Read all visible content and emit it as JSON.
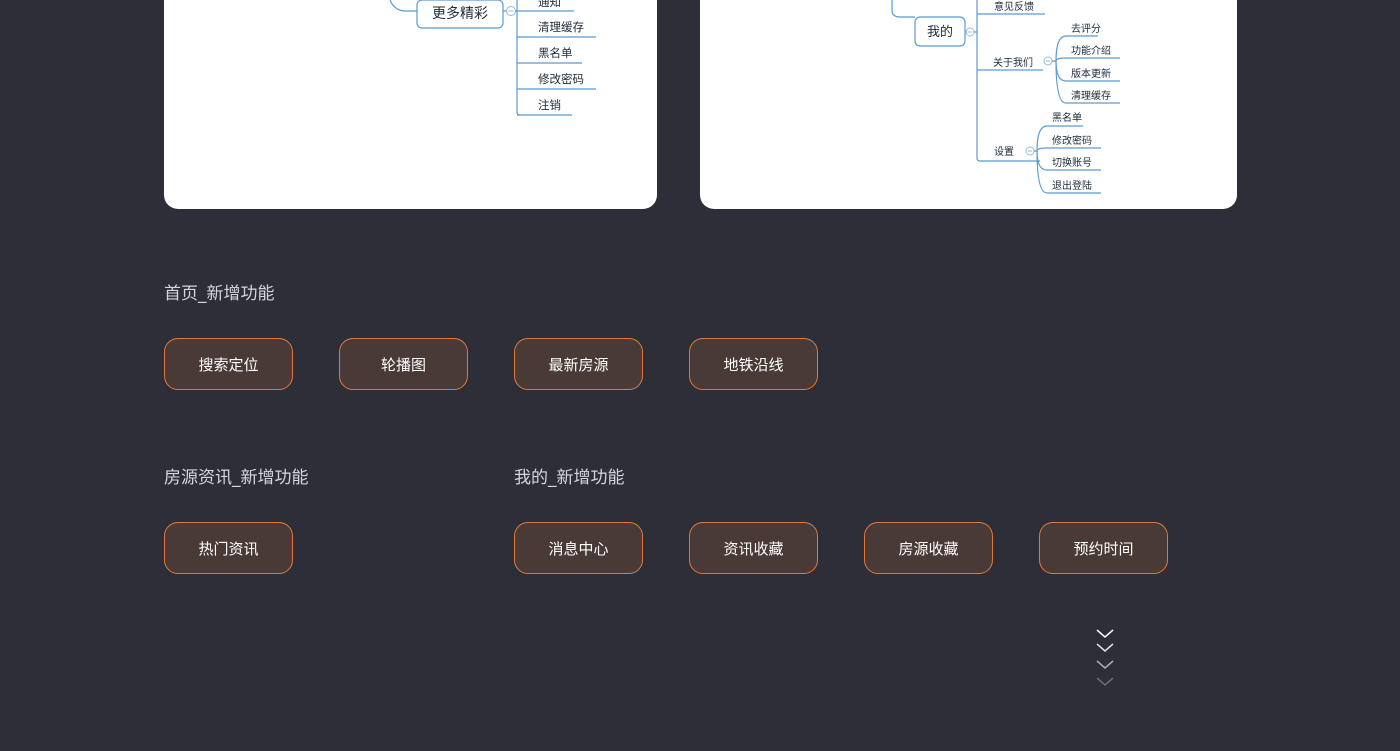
{
  "mindmap_left": {
    "parent": "更多精彩",
    "children": [
      "通知",
      "清理缓存",
      "黑名单",
      "修改密码",
      "注销"
    ]
  },
  "mindmap_right": {
    "root": "我的",
    "top_item": "意见反馈",
    "about": {
      "label": "关于我们",
      "items": [
        "去评分",
        "功能介绍",
        "版本更新",
        "清理缓存"
      ]
    },
    "settings": {
      "label": "设置",
      "items": [
        "黑名单",
        "修改密码",
        "切换账号",
        "退出登陆"
      ]
    }
  },
  "sections": {
    "home": {
      "title": "首页_新增功能",
      "buttons": [
        "搜索定位",
        "轮播图",
        "最新房源",
        "地铁沿线"
      ]
    },
    "news": {
      "title": "房源资讯_新增功能",
      "buttons": [
        "热门资讯"
      ]
    },
    "mine": {
      "title": "我的_新增功能",
      "buttons": [
        "消息中心",
        "资讯收藏",
        "房源收藏",
        "预约时间"
      ]
    }
  },
  "colors": {
    "background": "#2d2e38",
    "button_border": "#e2793a",
    "button_fill": "#4a3a37",
    "line": "#5b9bd5"
  },
  "icons": {
    "scroll_indicator": "chevron-down-icon"
  }
}
